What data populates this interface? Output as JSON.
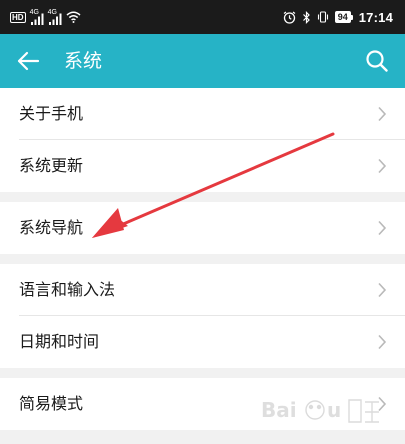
{
  "status_bar": {
    "hd": "HD",
    "net1": "4G",
    "net2": "4G",
    "battery": "94",
    "time": "17:14"
  },
  "app_bar": {
    "title": "系统",
    "back_icon": "arrow-left-icon",
    "search_icon": "search-icon"
  },
  "groups": [
    {
      "items": [
        {
          "label": "关于手机"
        },
        {
          "label": "系统更新"
        }
      ]
    },
    {
      "items": [
        {
          "label": "系统导航"
        }
      ]
    },
    {
      "items": [
        {
          "label": "语言和输入法"
        },
        {
          "label": "日期和时间"
        }
      ]
    },
    {
      "items": [
        {
          "label": "简易模式"
        }
      ]
    }
  ],
  "colors": {
    "app_bar": "#26b3c6",
    "status_bar": "#1b1b1b",
    "annotation": "#e5393f"
  }
}
